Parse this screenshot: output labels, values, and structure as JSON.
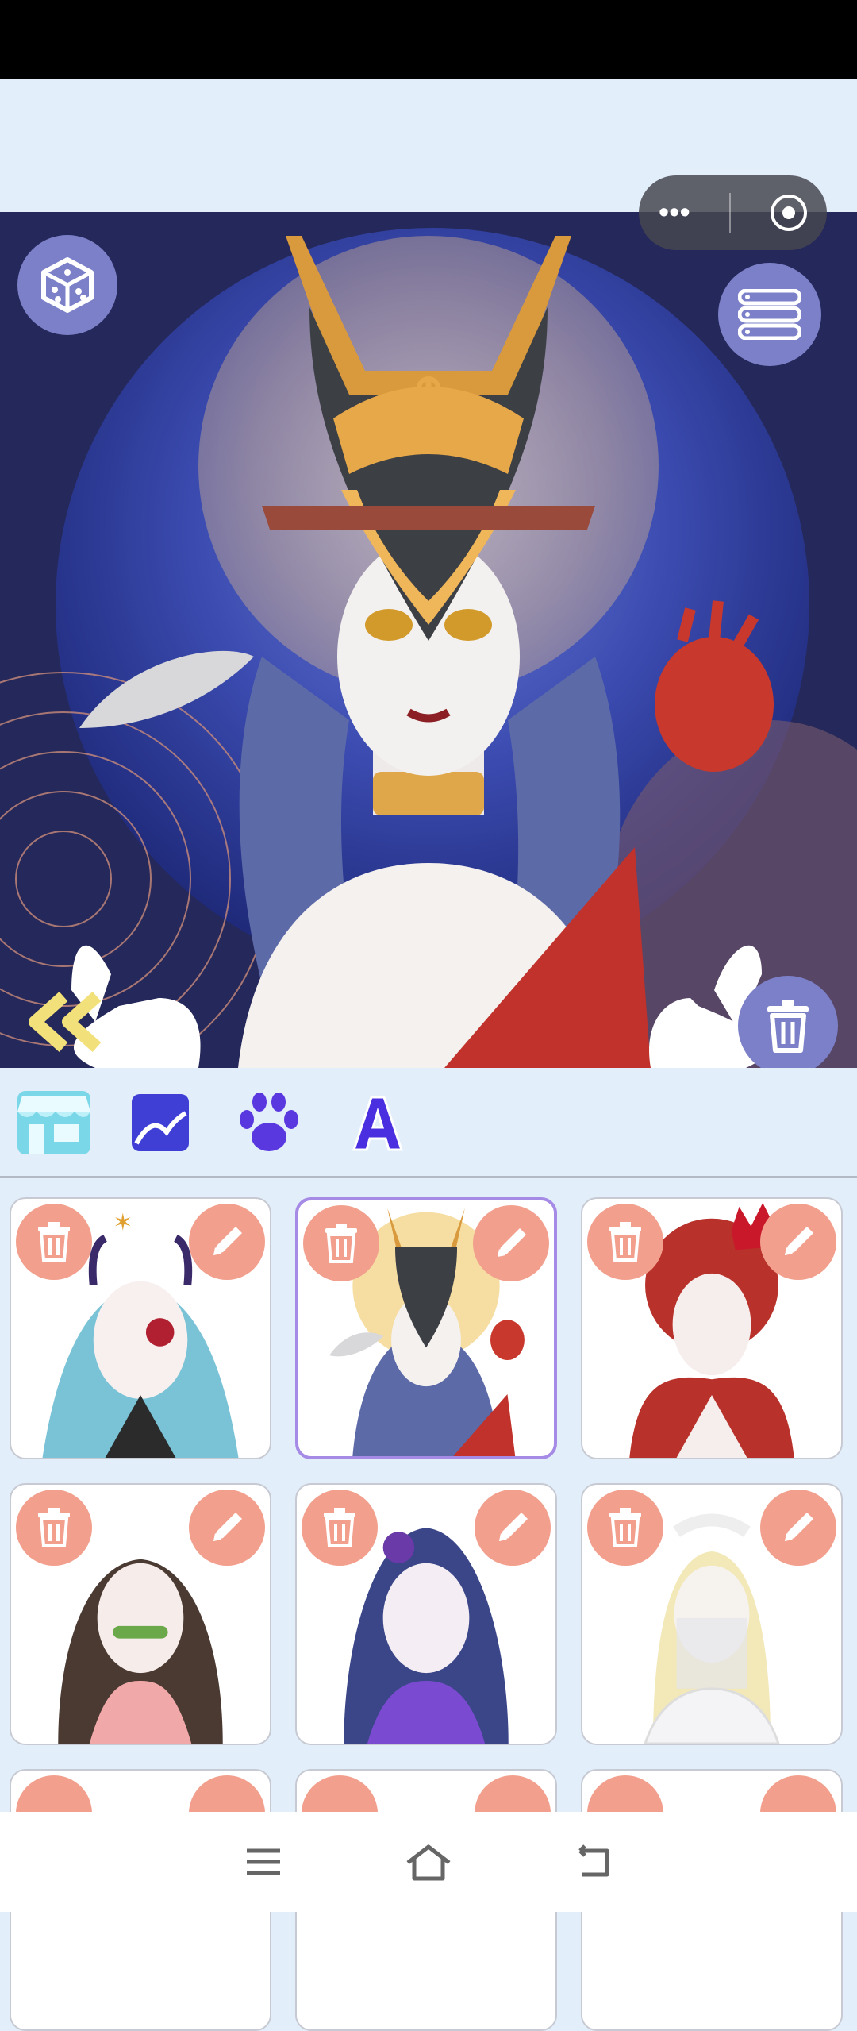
{
  "app": {
    "mini_program_menu_icon": "more-dots-icon",
    "mini_program_close_icon": "target-icon"
  },
  "canvas": {
    "left_top_icon": "dice-icon",
    "right_top_icon": "list-menu-icon",
    "left_bottom_icon": "double-chevron-left-icon",
    "right_bottom_icon": "trash-icon"
  },
  "toolbar": {
    "tabs": [
      {
        "icon": "store-icon",
        "active": true
      },
      {
        "icon": "background-icon"
      },
      {
        "icon": "paw-icon"
      },
      {
        "icon": "text-icon",
        "glyph": "A"
      }
    ]
  },
  "gallery": {
    "items": [
      {
        "theme": "demon-girl",
        "selected": false
      },
      {
        "theme": "anubis-mask",
        "selected": true
      },
      {
        "theme": "red-queen",
        "selected": false
      },
      {
        "theme": "bamboo-girl",
        "selected": false
      },
      {
        "theme": "purple-rose",
        "selected": false
      },
      {
        "theme": "veiled-bride",
        "selected": false
      },
      {
        "theme": "partial-1",
        "selected": false
      },
      {
        "theme": "partial-2",
        "selected": false
      },
      {
        "theme": "partial-3",
        "selected": false
      }
    ]
  },
  "nav": {
    "menu_icon": "menu-icon",
    "home_icon": "home-icon",
    "back_icon": "back-icon"
  },
  "colors": {
    "accent": "#7c80c8",
    "card_button": "#f2a08d",
    "selected_border": "#a58ae6",
    "tool_purple": "#4a3fe0"
  }
}
